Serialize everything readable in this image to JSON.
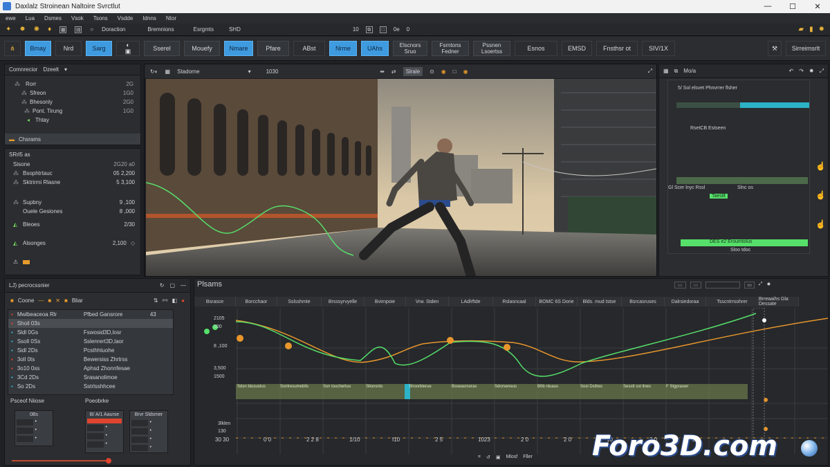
{
  "window": {
    "title": "Daxlalz Stroinean Naltoire Svrctlut",
    "buttons": [
      "—",
      "☐",
      "✕"
    ]
  },
  "menubar": [
    "ewe",
    "Lua",
    "Dsmes",
    "Vsok",
    "Tsons",
    "Vsdde",
    "Idnns",
    "Ntor"
  ],
  "quickbar": {
    "items": [
      "Doraction",
      "Bremnions",
      "Esrgmts",
      "SHD"
    ],
    "right": [
      "10",
      "0e",
      "0"
    ]
  },
  "toolbar": {
    "buttons": [
      "Bmay",
      "Nrd",
      "Sarg",
      "Sserel",
      "Mouefy",
      "Nmare",
      "Pfare",
      "ABst",
      "Nrme",
      "UAhs"
    ],
    "two_line": [
      [
        "Elscnors",
        "Sruo"
      ],
      [
        "Fsrntons",
        "Fedner"
      ],
      [
        "Pssnen",
        "Lsoertss"
      ]
    ],
    "extra": [
      "Esnos",
      "EMSD",
      "Fnsthsr ot",
      "SIV/1X"
    ],
    "right_label": "Sirreimsrlt"
  },
  "outliner": {
    "title": "Comnrecior",
    "dropdown": "Dzeelt",
    "items": [
      {
        "label": "Rorr",
        "value": "2G"
      },
      {
        "label": "Sfreon",
        "value": "1G0"
      },
      {
        "label": "Bhesonly",
        "value": "2G0"
      },
      {
        "label": "Pont. Tirung",
        "value": "1G0"
      },
      {
        "label": "Thtay",
        "value": ""
      }
    ],
    "selected": "Chsrams"
  },
  "properties": {
    "title": "SRrl5 as",
    "header_label": "Sisone",
    "header_value": "2G20 a0",
    "rows": [
      {
        "label": "Bsophtrtauc",
        "value": "05 2,200"
      },
      {
        "label": "Sktrirmi Rlasne",
        "value": "5 3,100"
      },
      {
        "label": "Supbny",
        "value": "9 ,100"
      },
      {
        "label": "Ouele Gesiones",
        "value": "8 ,000"
      },
      {
        "label": "Bleoes",
        "value": "2/30"
      },
      {
        "label": "Alsonges",
        "value": "2,100"
      },
      {
        "label": "",
        "value": ""
      }
    ]
  },
  "viewport": {
    "camera": "Stadorne",
    "zoom": "1030",
    "mode": "Slrale"
  },
  "right_panel": {
    "header": "Mo/a",
    "subtitle": "5/ Sol elsvet Phnvrrer flsher",
    "label1": "RsetCB Estseen",
    "row1": "Gl Scer lnyc Rssl",
    "row1_val": "Slnc os",
    "row2": "Taesllt",
    "row3": "DES e2 Eroumtolus",
    "row3_val": "Sloo tdoc"
  },
  "bottom_left": {
    "title": "LJ) pecrocssnier",
    "tabs": [
      "Coone",
      "Bliar"
    ],
    "list": [
      {
        "a": "Mwlbeaceoa Rlr",
        "b": "Pfbed Gansrore",
        "c": "43"
      },
      {
        "a": "Shoil 03s",
        "b": "",
        "c": ""
      },
      {
        "a": "Sldl 0Gs",
        "b": "Fswosid3D,losr",
        "c": ""
      },
      {
        "a": "Ssoll 0Ss",
        "b": "Sslenrert3D,laor",
        "c": ""
      },
      {
        "a": "Sidl 2Ds",
        "b": "Pcsthhtuohe",
        "c": ""
      },
      {
        "a": "3oll 0ts",
        "b": "Bewersiss Zhrtrss",
        "c": ""
      },
      {
        "a": "3o10 0ss",
        "b": "Aphsd Zhonnfesae",
        "c": ""
      },
      {
        "a": "3Cd 2Ds",
        "b": "Srasanolimoe",
        "c": ""
      },
      {
        "a": "So 2Ds",
        "b": "Sstrlsshhcee",
        "c": ""
      }
    ],
    "footer_left": "Psceof Niiose",
    "footer_right": "Poeobrke",
    "grids": [
      "0Bs",
      "B/ A/1 Aaurse",
      "Brvr Sldsmer"
    ]
  },
  "graph": {
    "title": "Plsams",
    "columns": [
      "Bsrasce",
      "Borcchaor",
      "Sslsshmte",
      "Brsssyrvyelle",
      "Bvirnpoie",
      "Vrw. Stden",
      "LAdlrftde",
      "Rslasncaal",
      "BOMC 6S Dorie",
      "Blds. mud tstse",
      "Bsrcasruses",
      "Dalrsiedoraa",
      "Tsscntrrsohrer",
      "Brreaaihs Gla Dessate"
    ],
    "y_labels": [
      "2105",
      "100",
      "8 ,100",
      "3,500",
      "1500"
    ],
    "y_extra": [
      "3lklen",
      "130"
    ],
    "x_labels": [
      "30 30",
      "0 0",
      "2 2 8",
      "1/10",
      "f10",
      "2 5",
      "1023",
      "2 0",
      "2 0",
      "10",
      "2 0",
      "2 0"
    ],
    "footer": [
      "Mlosf",
      "Fller"
    ],
    "track_labels": [
      "Sdsn blusuolus",
      "Ssntresumeblls",
      "Ssn toucherluu",
      "Sllonsnts",
      "Shoorblerue",
      "Bsseasrsoras",
      "Sdorseneus",
      "B0b nluaus",
      "Sosl Dstlres",
      "Sesstt sst llnes",
      "F Stgpraswr"
    ]
  },
  "watermark": {
    "text": "Foro3D.com"
  },
  "colors": {
    "accent_blue": "#3f9be0",
    "curve_green": "#56e06a",
    "curve_orange": "#e8962c",
    "panel": "#2b2d30"
  }
}
